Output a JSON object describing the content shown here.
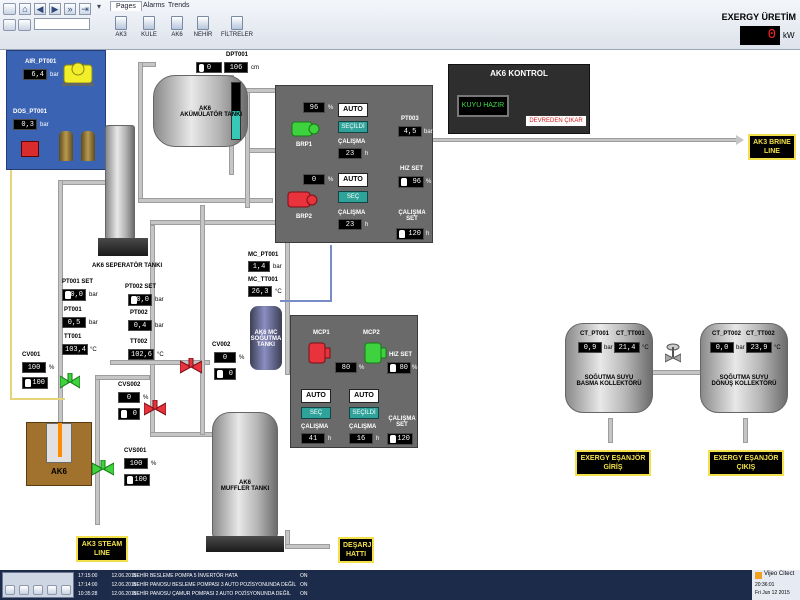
{
  "toolbar": {
    "tabs": [
      "Pages",
      "Alarms",
      "Trends"
    ],
    "active_tab": "Pages",
    "quick_buttons": [
      "AK3",
      "KULE",
      "AK6",
      "NEHİR",
      "FİLTRELER"
    ],
    "header_title": "EXERGY ÜRETİM",
    "production_value": "0",
    "production_unit": "kW"
  },
  "compressor": {
    "air_label": "AIR_PT001",
    "air_value": "6,4",
    "air_unit": "bar",
    "dos_label": "DOS_PT001",
    "dos_value": "0,3",
    "dos_unit": "bar"
  },
  "accumulator": {
    "dp_label": "DPT001",
    "dp_hand": "0",
    "dp_value": "106",
    "dp_unit": "cm",
    "name_line1": "AK6",
    "name_line2": "AKÜMÜLATÖR TANKI"
  },
  "separator": {
    "name": "AK6 SEPERATÖR TANKI"
  },
  "brine_panel": {
    "brp1_speed": "96",
    "brp1_speed_unit": "%",
    "brp1_mode": "AUTO",
    "brp1_select": "SEÇİLDİ",
    "brp1_label": "BRP1",
    "brp1_run_label": "ÇALIŞMA",
    "brp1_run": "23",
    "brp1_run_unit": "h",
    "brp2_speed": "0",
    "brp2_speed_unit": "%",
    "brp2_mode": "AUTO",
    "brp2_select": "SEÇ",
    "brp2_label": "BRP2",
    "brp2_run_label": "ÇALIŞMA",
    "brp2_run": "23",
    "brp2_run_unit": "h",
    "pt003_label": "PT003",
    "pt003_value": "4,5",
    "pt003_unit": "bar",
    "hiz_set_label": "HIZ SET",
    "hiz_set_value": "96",
    "hiz_set_unit": "%",
    "calisma_set_label": "ÇALIŞMA SET",
    "calisma_set_value": "120",
    "calisma_set_unit": "h"
  },
  "control": {
    "title": "AK6 KONTROL",
    "status": "KUYU HAZIR",
    "button": "DEVREDEN ÇIKAR"
  },
  "ak3_brine": "AK3 BRINE LINE",
  "mc": {
    "pt_label": "MC_PT001",
    "pt_value": "1,4",
    "pt_unit": "bar",
    "tt_label": "MC_TT001",
    "tt_value": "26,3",
    "tt_unit": "°C",
    "tank_line1": "AK6 MC",
    "tank_line2": "SOĞUTMA",
    "tank_line3": "TANKI"
  },
  "mc_panel": {
    "mcp1_label": "MCP1",
    "mcp2_label": "MCP2",
    "speed_value": "80",
    "speed_unit": "%",
    "hiz_set_label": "HIZ SET",
    "hiz_set_value": "80",
    "hiz_set_unit": "%",
    "mcp1_mode": "AUTO",
    "mcp1_select": "SEÇ",
    "mcp1_run_label": "ÇALIŞMA",
    "mcp1_run": "41",
    "mcp1_run_unit": "h",
    "mcp2_mode": "AUTO",
    "mcp2_select": "SEÇİLDİ",
    "mcp2_run_label": "ÇALIŞMA",
    "mcp2_run": "16",
    "mcp2_run_unit": "h",
    "calisma_set_label": "ÇALIŞMA SET",
    "calisma_set_value": "120",
    "calisma_set_unit": "h"
  },
  "well": {
    "pt001_set_label": "PT001 SET",
    "pt001_set": "0,0",
    "pt001_set_unit": "bar",
    "pt001_label": "PT001",
    "pt001": "0,5",
    "pt001_unit": "bar",
    "tt001_label": "TT001",
    "tt001": "103,4",
    "tt001_unit": "°C",
    "pt002_set_label": "PT002 SET",
    "pt002_set": "0,0",
    "pt002_set_unit": "bar",
    "pt002_label": "PT002",
    "pt002": "0,4",
    "pt002_unit": "bar",
    "tt002_label": "TT002",
    "tt002": "102,6",
    "tt002_unit": "°C",
    "cv001_label": "CV001",
    "cv001_value": "100",
    "cv001_hand": "100",
    "cv001_unit": "%",
    "well_name": "AK6"
  },
  "valves": {
    "cv002_label": "CV002",
    "cv002_value": "0",
    "cv002_hand": "0",
    "cv002_unit": "%",
    "cvs002_label": "CVS002",
    "cvs002_value": "0",
    "cvs002_hand": "0",
    "cvs002_unit": "%",
    "cvs001_label": "CVS001",
    "cvs001_value": "100",
    "cvs001_hand": "100",
    "cvs001_unit": "%"
  },
  "muffler": {
    "line1": "AK6",
    "line2": "MUFFLER TANKI"
  },
  "destinations": {
    "ak3_steam": "AK3 STEAM LINE",
    "desarj": "DEŞARJ HATTI",
    "exch_in": "EXERGY EŞANJÖR GİRİŞ",
    "exch_out": "EXERGY EŞANJÖR ÇIKIŞ"
  },
  "cooling": {
    "supply_pt_label": "CT_PT001",
    "supply_pt": "0,9",
    "supply_pt_unit": "bar",
    "supply_tt_label": "CT_TT001",
    "supply_tt": "21,4",
    "supply_tt_unit": "°C",
    "supply_line1": "SOĞUTMA SUYU",
    "supply_line2": "BASMA KOLLEKTÖRÜ",
    "return_pt_label": "CT_PT002",
    "return_pt": "0,0",
    "return_pt_unit": "bar",
    "return_tt_label": "CT_TT002",
    "return_tt": "23,9",
    "return_tt_unit": "°C",
    "return_line1": "SOĞUTMA SUYU",
    "return_line2": "DÖNÜŞ KOLLEKTÖRÜ"
  },
  "alarms": [
    {
      "time": "17:15:00",
      "date": "12.06.2015",
      "text": "NEHİR BESLEME POMPA 5 İNVERTÖR HATA",
      "state": "ON"
    },
    {
      "time": "17:14:00",
      "date": "12.06.2015",
      "text": "NEHİR PANOSU BESLEME POMPASI 3 AUTO POZİSYONUNDA DEĞİL",
      "state": "ON"
    },
    {
      "time": "10:35:28",
      "date": "12.06.2015",
      "text": "NEHİR PANOSU ÇAMUR POMPASI 2 AUTO POZİSYONUNDA DEĞİL",
      "state": "ON"
    }
  ],
  "status": {
    "brand": "Vijeo Citect",
    "time": "20:36:01",
    "date": "Fri Jun 12 2015"
  },
  "colors": {
    "selected_motor": "#3fd23f",
    "standby_motor": "#e8323c",
    "destination_border": "#f2e14a",
    "select_button": "#2fa39a"
  }
}
